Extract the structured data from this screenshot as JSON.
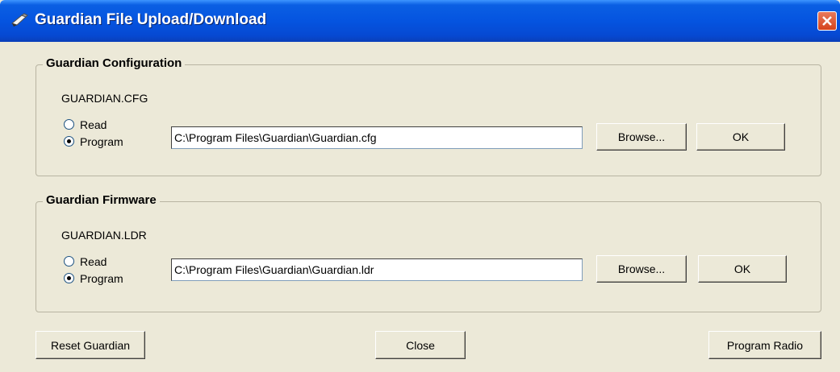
{
  "window": {
    "title": "Guardian File Upload/Download",
    "title_icon": "pencil-icon",
    "close_icon": "close-icon"
  },
  "config_group": {
    "title": "Guardian Configuration",
    "file_label": "GUARDIAN.CFG",
    "radio_read": "Read",
    "radio_program": "Program",
    "selected_mode": "Program",
    "path": "C:\\Program Files\\Guardian\\Guardian.cfg",
    "browse_label": "Browse...",
    "ok_label": "OK"
  },
  "firmware_group": {
    "title": "Guardian Firmware",
    "file_label": "GUARDIAN.LDR",
    "radio_read": "Read",
    "radio_program": "Program",
    "selected_mode": "Program",
    "path": "C:\\Program Files\\Guardian\\Guardian.ldr",
    "browse_label": "Browse...",
    "ok_label": "OK"
  },
  "footer": {
    "reset_label": "Reset Guardian",
    "close_label": "Close",
    "program_radio_label": "Program Radio"
  },
  "colors": {
    "titlebar": "#0554e0",
    "close_button": "#d5431c",
    "dialog_background": "#ece9d8"
  }
}
